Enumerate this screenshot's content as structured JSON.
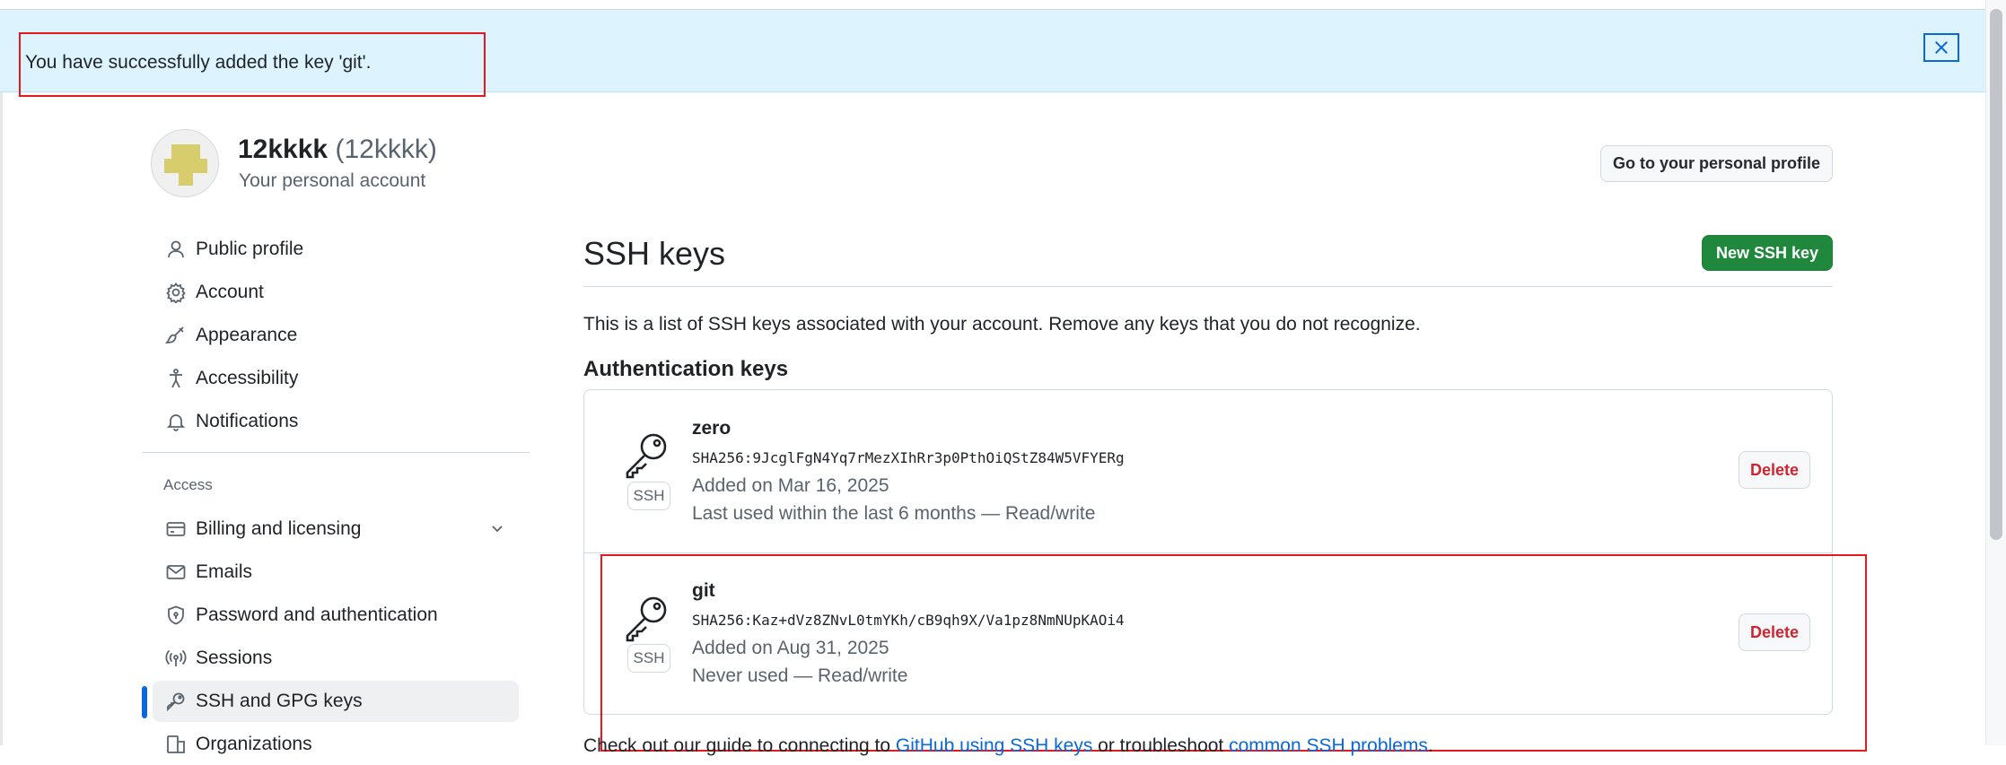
{
  "flash": {
    "message": "You have successfully added the key 'git'.",
    "close_icon": "close-icon"
  },
  "profile": {
    "name": "12kkkk",
    "login": "(12kkkk)",
    "subtitle": "Your personal account",
    "go_to_profile_label": "Go to your personal profile"
  },
  "sidebar": {
    "items": [
      {
        "label": "Public profile",
        "icon": "person-icon"
      },
      {
        "label": "Account",
        "icon": "gear-icon"
      },
      {
        "label": "Appearance",
        "icon": "paintbrush-icon"
      },
      {
        "label": "Accessibility",
        "icon": "accessibility-icon"
      },
      {
        "label": "Notifications",
        "icon": "bell-icon"
      }
    ],
    "access_heading": "Access",
    "access_items": [
      {
        "label": "Billing and licensing",
        "icon": "credit-card-icon"
      },
      {
        "label": "Emails",
        "icon": "mail-icon"
      },
      {
        "label": "Password and authentication",
        "icon": "shield-lock-icon"
      },
      {
        "label": "Sessions",
        "icon": "broadcast-icon"
      },
      {
        "label": "SSH and GPG keys",
        "icon": "key-icon",
        "active": true
      },
      {
        "label": "Organizations",
        "icon": "organization-icon"
      }
    ]
  },
  "main": {
    "title": "SSH keys",
    "new_key_label": "New SSH key",
    "description": "This is a list of SSH keys associated with your account. Remove any keys that you do not recognize.",
    "auth_heading": "Authentication keys",
    "keys": [
      {
        "title": "zero",
        "fingerprint": "SHA256:9JcglFgN4Yq7rMezXIhRr3p0PthOiQStZ84W5VFYERg",
        "added": "Added on Mar 16, 2025",
        "last_used": "Last used within the last 6 months — Read/write",
        "badge": "SSH",
        "delete_label": "Delete"
      },
      {
        "title": "git",
        "fingerprint": "SHA256:Kaz+dVz8ZNvL0tmYKh/cB9qh9X/Va1pz8NmNUpKAOi4",
        "added": "Added on Aug 31, 2025",
        "last_used": "Never used — Read/write",
        "badge": "SSH",
        "delete_label": "Delete"
      }
    ],
    "footer_prefix": "Check out our guide to connecting to ",
    "footer_link1": "GitHub using SSH keys",
    "footer_middle": " or troubleshoot ",
    "footer_link2": "common SSH problems",
    "footer_suffix": "."
  },
  "colors": {
    "flash_bg": "#ddf4ff",
    "primary_button": "#1f883d",
    "danger": "#d1242f",
    "accent": "#0969da",
    "annotation_red": "#e5181e"
  }
}
